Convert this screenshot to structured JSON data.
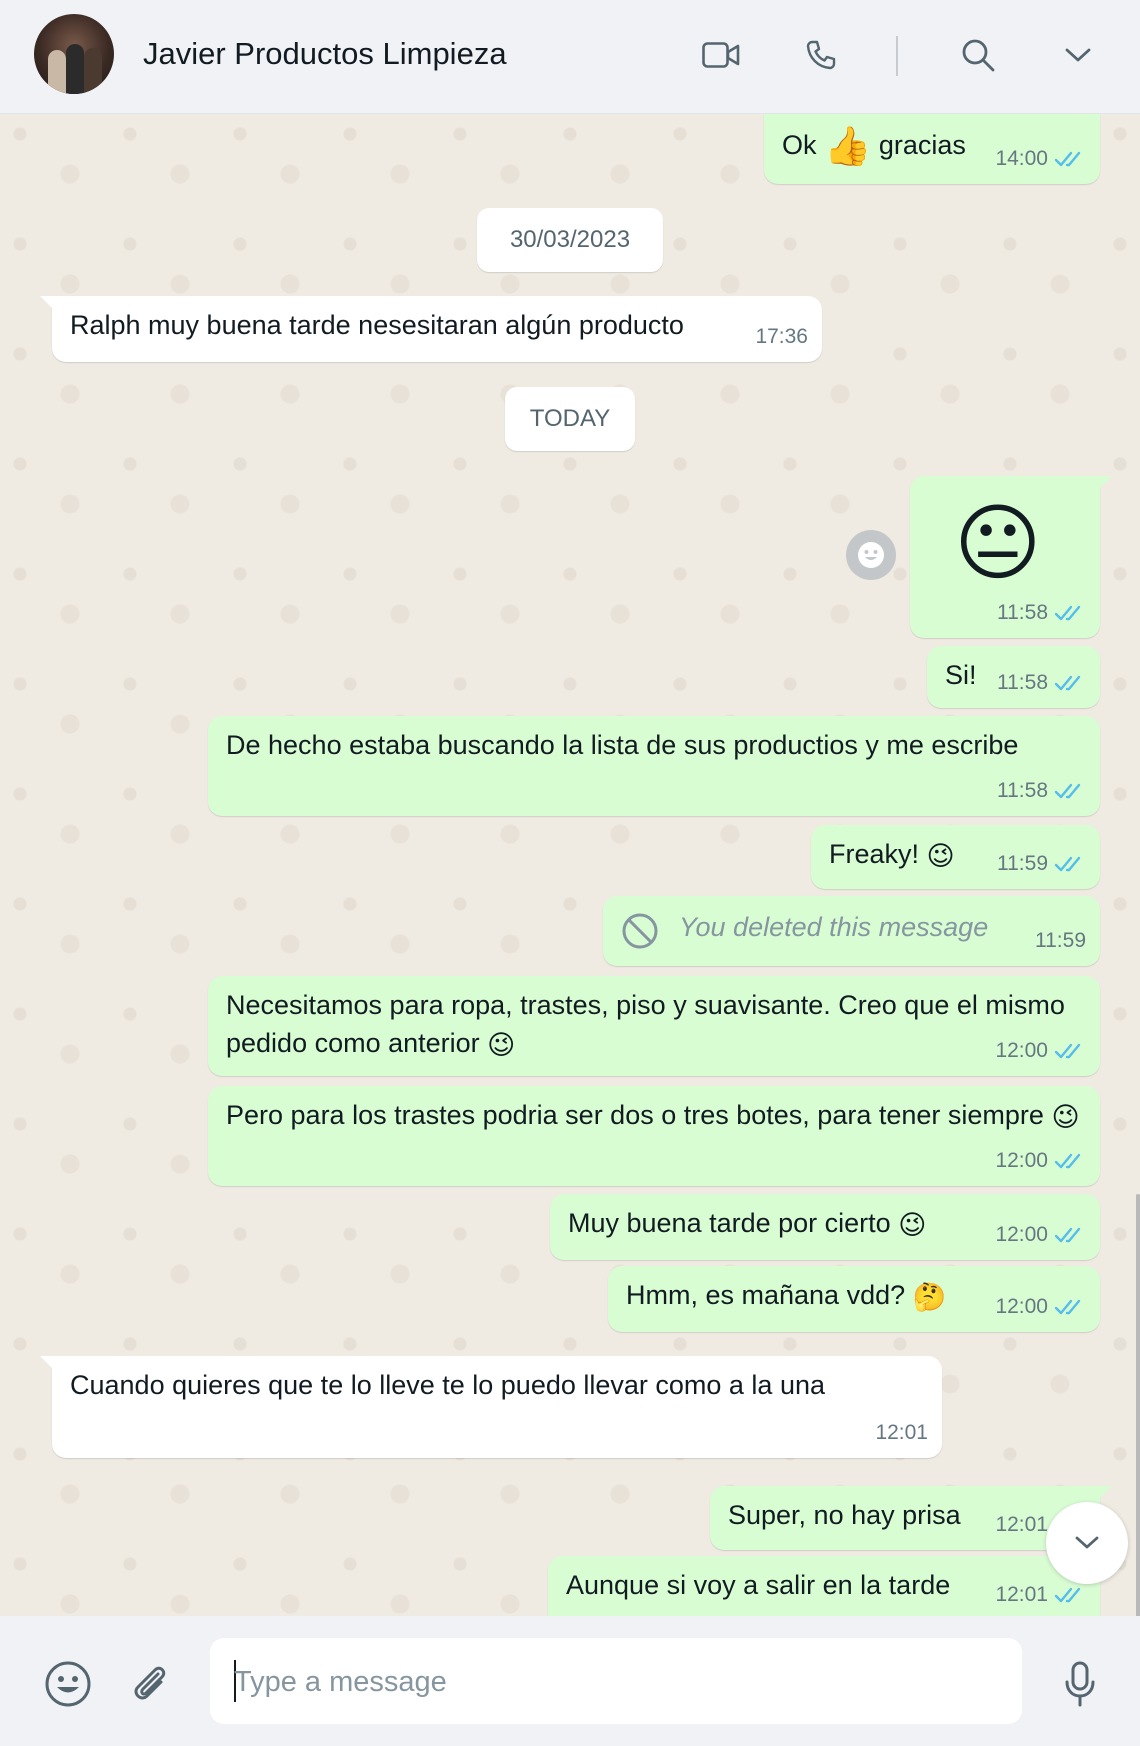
{
  "header": {
    "contact_name": "Javier Productos Limpieza",
    "icons": [
      "video-call-icon",
      "voice-call-icon",
      "search-icon",
      "chevron-down-icon"
    ]
  },
  "date_separators": [
    "30/03/2023",
    "TODAY"
  ],
  "messages": [
    {
      "id": "m1",
      "direction": "outgoing",
      "text_before": "Ok",
      "emoji": "👍",
      "text_after": "gracias",
      "time": "14:00",
      "status": "read"
    },
    {
      "id": "m2",
      "direction": "incoming",
      "text": "Ralph muy buena tarde nesesitaran algún producto",
      "time": "17:36"
    },
    {
      "id": "m3",
      "direction": "outgoing",
      "emoji": "😐",
      "time": "11:58",
      "status": "read"
    },
    {
      "id": "m4",
      "direction": "outgoing",
      "text": "Si!",
      "time": "11:58",
      "status": "read"
    },
    {
      "id": "m5",
      "direction": "outgoing",
      "text": "De hecho estaba buscando la lista de sus productios y me escribe",
      "time": "11:58",
      "status": "read"
    },
    {
      "id": "m6",
      "direction": "outgoing",
      "text": "Freaky!",
      "emoji": "😉",
      "time": "11:59",
      "status": "read"
    },
    {
      "id": "m7",
      "direction": "outgoing",
      "text": "You deleted this message",
      "deleted": true,
      "time": "11:59"
    },
    {
      "id": "m8",
      "direction": "outgoing",
      "text": "Necesitamos para ropa, trastes, piso y suavisante. Creo que el mismo pedido como anterior",
      "emoji": "😉",
      "time": "12:00",
      "status": "read"
    },
    {
      "id": "m9",
      "direction": "outgoing",
      "text": "Pero para los trastes podria ser dos o tres botes, para tener siempre",
      "emoji": "😉",
      "time": "12:00",
      "status": "read"
    },
    {
      "id": "m10",
      "direction": "outgoing",
      "text": "Muy buena tarde por cierto",
      "emoji": "😉",
      "time": "12:00",
      "status": "read"
    },
    {
      "id": "m11",
      "direction": "outgoing",
      "text": "Hmm, es mañana vdd?",
      "emoji": "🤔",
      "time": "12:00",
      "status": "read"
    },
    {
      "id": "m12",
      "direction": "incoming",
      "text": "Cuando quieres que te lo lleve te lo puedo llevar como a la una",
      "time": "12:01"
    },
    {
      "id": "m13",
      "direction": "outgoing",
      "text": "Super, no hay prisa",
      "time": "12:01",
      "status": "read"
    },
    {
      "id": "m14",
      "direction": "outgoing",
      "text": "Aunque si voy a salir en la tarde",
      "time": "12:01",
      "status": "read"
    }
  ],
  "composer": {
    "placeholder": "Type a message",
    "icons": [
      "emoji-icon",
      "attach-icon",
      "microphone-icon"
    ]
  },
  "colors": {
    "outgoing_bubble": "#d9fdd3",
    "incoming_bubble": "#ffffff",
    "read_ticks": "#53bdeb",
    "chat_background": "#efeae2",
    "header_background": "#f0f2f5"
  }
}
